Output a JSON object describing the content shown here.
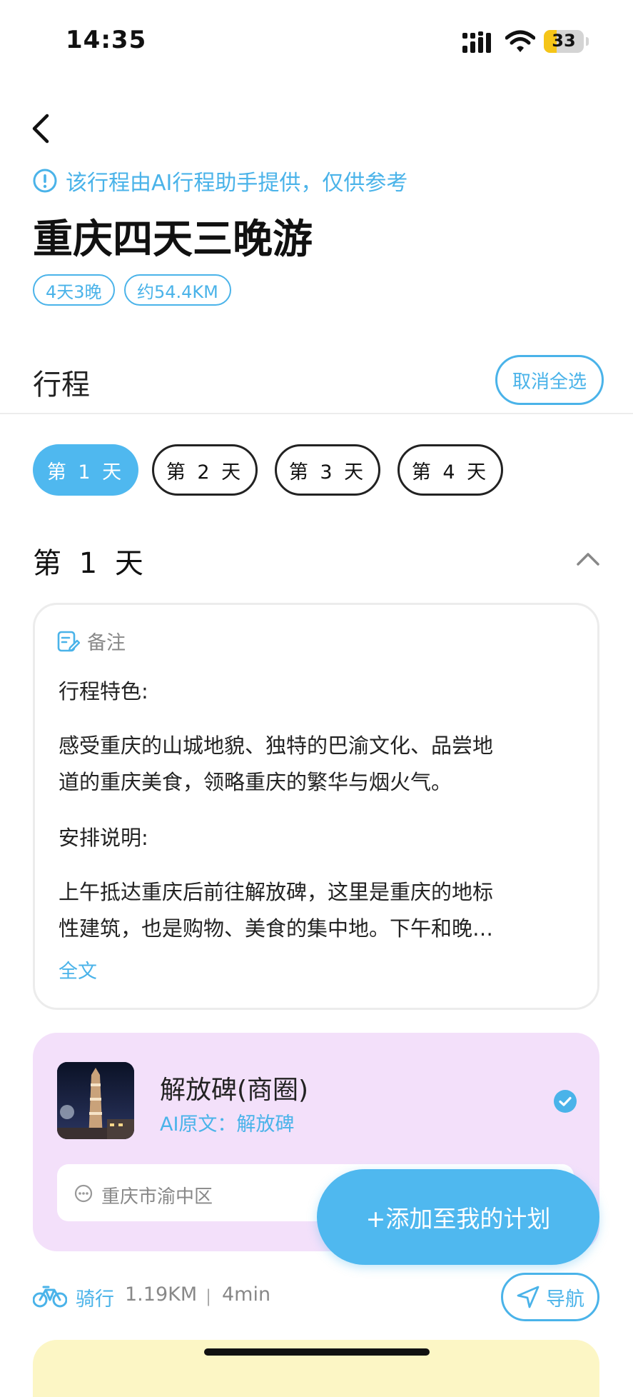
{
  "status_bar": {
    "time": "14:35",
    "battery": "33",
    "battery_level": 0.33
  },
  "header": {
    "notice": "该行程由AI行程助手提供，仅供参考",
    "title": "重庆四天三晚游",
    "tags": [
      "4天3晚",
      "约54.4KM"
    ]
  },
  "itinerary": {
    "section_title": "行程",
    "cancel_select_all": "取消全选",
    "day_tabs": [
      "第 1 天",
      "第 2 天",
      "第 3 天",
      "第 4 天"
    ],
    "active_day": 0,
    "day_heading": "第 1 天"
  },
  "note": {
    "label": "备注",
    "features_title": "行程特色:",
    "features_line1": "感受重庆的山城地貌、独特的巴渝文化、品尝地",
    "features_line2": "道的重庆美食，领略重庆的繁华与烟火气。",
    "arrangement_title": "安排说明:",
    "arrangement_line1": "上午抵达重庆后前往解放碑，这里是重庆的地标",
    "arrangement_line2": "性建筑，也是购物、美食的集中地。下午和晚…",
    "full_text": "全文"
  },
  "poi": {
    "name": "解放碑(商圈)",
    "ai_original": "AI原文：解放碑",
    "address": "重庆市渝中区",
    "selected": true
  },
  "add_plan_button": "+添加至我的计划",
  "route": {
    "mode": "骑行",
    "distance": "1.19KM",
    "separator": "|",
    "duration": "4min",
    "navigate": "导航"
  },
  "colors": {
    "accent": "#4ab3e9",
    "active_tab": "#4fb8ef",
    "poi_card_bg": "#f3e0fa",
    "next_card_bg": "#fcf6c5"
  }
}
